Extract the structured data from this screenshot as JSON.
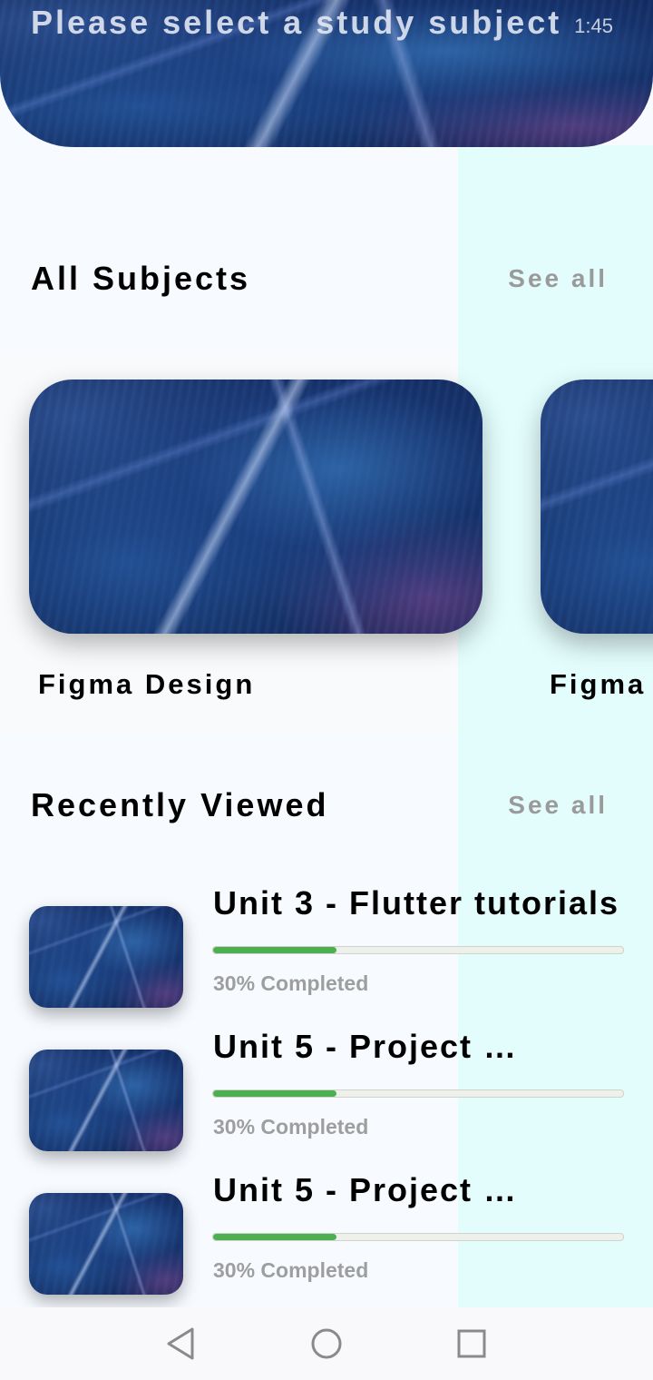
{
  "status_bar": {
    "left": "",
    "time": "1:45"
  },
  "header": {
    "title": "Please select a study subject"
  },
  "all_subjects": {
    "title": "All Subjects",
    "see_all": "See all",
    "items": [
      {
        "label": "Figma Design"
      },
      {
        "label": "Figma"
      }
    ]
  },
  "recently_viewed": {
    "title": "Recently Viewed",
    "see_all": "See all",
    "items": [
      {
        "title": "Unit 3 - Flutter tutorials",
        "progress": 0.3,
        "progress_text": "30% Completed"
      },
      {
        "title": "Unit 5 - Project …",
        "progress": 0.3,
        "progress_text": "30% Completed"
      },
      {
        "title": "Unit 5 - Project …",
        "progress": 0.3,
        "progress_text": "30% Completed"
      }
    ]
  },
  "colors": {
    "accent_progress": "#4caf50",
    "background": "#f7fbff",
    "right_tint": "#e3fdfd"
  },
  "nav": {
    "back_icon": "triangle-back-icon",
    "home_icon": "circle-home-icon",
    "recents_icon": "square-recents-icon"
  }
}
